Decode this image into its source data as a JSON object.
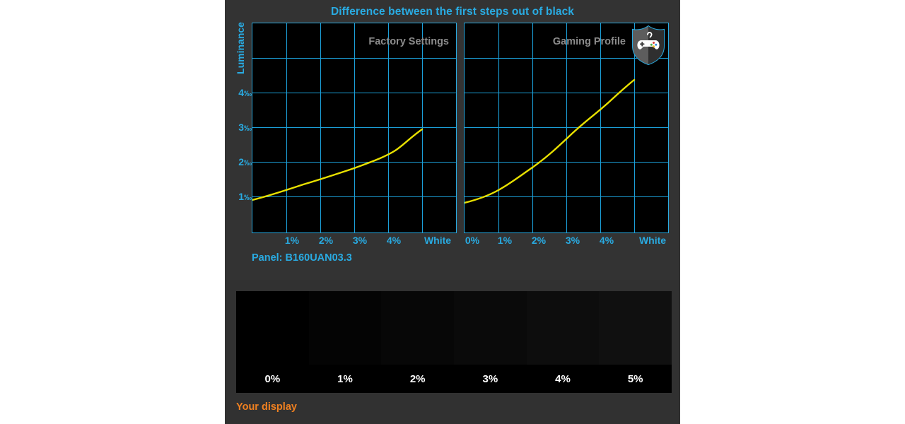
{
  "page": {
    "title": "Difference between the first steps out of black",
    "panel_name": "Panel: B160UAN03.3",
    "your_display_label": "Your display",
    "colors": {
      "accent_cyan": "#29abe2",
      "curve_yellow": "#e8e000",
      "panel_label_grey": "#8c8c8c",
      "orange": "#f08020",
      "panel_bg": "#333333",
      "plot_bg": "#000000"
    }
  },
  "axis": {
    "y_title": "Luminance",
    "y_ticks": [
      {
        "label": "1",
        "unit": "‰",
        "value": 1
      },
      {
        "label": "2",
        "unit": "‰",
        "value": 2
      },
      {
        "label": "3",
        "unit": "‰",
        "value": 3
      },
      {
        "label": "4",
        "unit": "‰",
        "value": 4
      }
    ]
  },
  "charts": [
    {
      "id": "factory",
      "label": "Factory Settings",
      "x_ticks": [
        "1%",
        "2%",
        "3%",
        "4%",
        "White"
      ],
      "badge": null
    },
    {
      "id": "gaming",
      "label": "Gaming Profile",
      "x_ticks": [
        "0%",
        "1%",
        "2%",
        "3%",
        "4%",
        "White"
      ],
      "badge": "gamepad-shield-icon"
    }
  ],
  "gradient_strip": {
    "bands": [
      "0%",
      "1%",
      "2%",
      "3%",
      "4%",
      "5%"
    ],
    "band_colors": [
      "#000000",
      "#040404",
      "#070707",
      "#0a0a0a",
      "#0d0d0d",
      "#101010"
    ]
  },
  "chart_data": [
    {
      "type": "line",
      "title": "Difference between the first steps out of black",
      "subtitle": "Factory Settings",
      "xlabel": "",
      "ylabel": "Luminance",
      "x": [
        0,
        1,
        2,
        3,
        4
      ],
      "xticklabels": [
        "",
        "1%",
        "2%",
        "3%",
        "4%"
      ],
      "series": [
        {
          "name": "Factory Settings",
          "values": [
            0.93,
            1.23,
            1.5,
            1.78,
            2.2
          ]
        }
      ],
      "ylim": [
        0,
        6
      ],
      "xlim": [
        0,
        6
      ],
      "yticks": [
        1,
        2,
        3,
        4
      ],
      "yticklabels": [
        "1‰",
        "2‰",
        "3‰",
        "4‰"
      ],
      "grid": true,
      "legend": "none",
      "units": "per-mille"
    },
    {
      "type": "line",
      "title": "Difference between the first steps out of black",
      "subtitle": "Gaming Profile",
      "xlabel": "",
      "ylabel": "Luminance",
      "x": [
        0,
        1,
        2,
        3,
        4
      ],
      "xticklabels": [
        "0%",
        "1%",
        "2%",
        "3%",
        "4%"
      ],
      "series": [
        {
          "name": "Gaming Profile",
          "values": [
            0.85,
            1.35,
            1.95,
            2.6,
            3.45
          ]
        }
      ],
      "ylim": [
        0,
        6
      ],
      "xlim": [
        0,
        6
      ],
      "yticks": [
        1,
        2,
        3,
        4
      ],
      "yticklabels": [
        "1‰",
        "2‰",
        "3‰",
        "4‰"
      ],
      "grid": true,
      "legend": "none",
      "units": "per-mille"
    }
  ]
}
